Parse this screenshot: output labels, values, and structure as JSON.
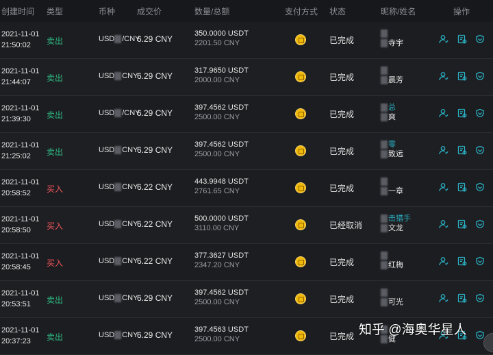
{
  "header": {
    "created": "创建时间",
    "type": "类型",
    "coin": "币种",
    "price": "成交价",
    "amount": "数量/总额",
    "payment": "支付方式",
    "status": "状态",
    "name": "昵称/姓名",
    "ops": "操作"
  },
  "rows": [
    {
      "date": "2021-11-01",
      "time": "21:50:02",
      "type": "卖出",
      "side": "sell",
      "coin_pre": "USD",
      "coin_post": "/CNY",
      "price": "6.29 CNY",
      "usdt": "350.0000 USDT",
      "cny": "2201.50 CNY",
      "status": "已完成",
      "nick": "",
      "real": "寺宇"
    },
    {
      "date": "2021-11-01",
      "time": "21:44:07",
      "type": "卖出",
      "side": "sell",
      "coin_pre": "USD",
      "coin_post": "CNY",
      "price": "6.29 CNY",
      "usdt": "317.9650 USDT",
      "cny": "2000.00 CNY",
      "status": "已完成",
      "nick": "",
      "real": "晨芳"
    },
    {
      "date": "2021-11-01",
      "time": "21:39:30",
      "type": "卖出",
      "side": "sell",
      "coin_pre": "USD",
      "coin_post": "/CNY",
      "price": "6.29 CNY",
      "usdt": "397.4562 USDT",
      "cny": "2500.00 CNY",
      "status": "已完成",
      "nick": "总",
      "real": "爽"
    },
    {
      "date": "2021-11-01",
      "time": "21:25:02",
      "type": "卖出",
      "side": "sell",
      "coin_pre": "USD",
      "coin_post": "CNY",
      "price": "6.29 CNY",
      "usdt": "397.4562 USDT",
      "cny": "2500.00 CNY",
      "status": "已完成",
      "nick": "零",
      "real": "致远"
    },
    {
      "date": "2021-11-01",
      "time": "20:58:52",
      "type": "买入",
      "side": "buy",
      "coin_pre": "USD",
      "coin_post": "CNY",
      "price": "6.22 CNY",
      "usdt": "443.9948 USDT",
      "cny": "2761.65 CNY",
      "status": "已完成",
      "nick": "",
      "real": "一章"
    },
    {
      "date": "2021-11-01",
      "time": "20:58:50",
      "type": "买入",
      "side": "buy",
      "coin_pre": "USD",
      "coin_post": "CNY",
      "price": "6.22 CNY",
      "usdt": "500.0000 USDT",
      "cny": "3110.00 CNY",
      "status": "已经取消",
      "nick": "击猎手",
      "real": "文龙"
    },
    {
      "date": "2021-11-01",
      "time": "20:58:45",
      "type": "买入",
      "side": "buy",
      "coin_pre": "USD",
      "coin_post": "CNY",
      "price": "6.22 CNY",
      "usdt": "377.3627 USDT",
      "cny": "2347.20 CNY",
      "status": "已完成",
      "nick": "",
      "real": "红梅"
    },
    {
      "date": "2021-11-01",
      "time": "20:53:51",
      "type": "卖出",
      "side": "sell",
      "coin_pre": "USD",
      "coin_post": "CNY",
      "price": "6.29 CNY",
      "usdt": "397.4562 USDT",
      "cny": "2500.00 CNY",
      "status": "已完成",
      "nick": "",
      "real": "可光"
    },
    {
      "date": "2021-11-01",
      "time": "20:37:23",
      "type": "卖出",
      "side": "sell",
      "coin_pre": "USD",
      "coin_post": "CNY",
      "price": "6.29 CNY",
      "usdt": "397.4563 USDT",
      "cny": "2500.00 CNY",
      "status": "已完成",
      "nick": "",
      "real": "健"
    }
  ],
  "watermark": "知乎 @海奥华星人",
  "colors": {
    "sell": "#2ebd85",
    "buy": "#f0545c",
    "accent": "#2ab3c7",
    "coin": "#f0b90b"
  },
  "icons": {
    "payment": "coin-icon",
    "op1": "user-icon",
    "op2": "order-icon",
    "op3": "shield-icon"
  }
}
